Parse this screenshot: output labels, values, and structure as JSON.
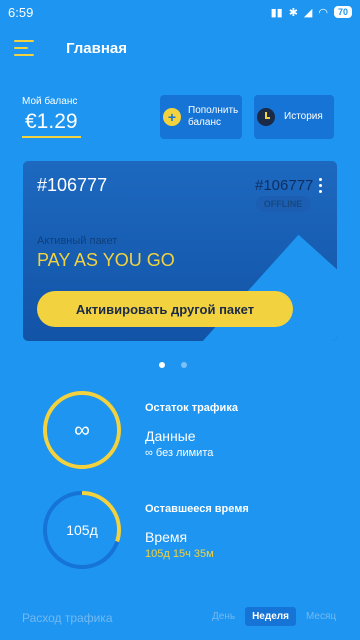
{
  "status_bar": {
    "time": "6:59",
    "battery": "70"
  },
  "header": {
    "title": "Главная"
  },
  "balance": {
    "label": "Мой баланс",
    "value": "€1.29"
  },
  "actions": {
    "topup_label_line1": "Пополнить",
    "topup_label_line2": "баланс",
    "history_label": "История"
  },
  "card": {
    "id": "#106777",
    "id_secondary": "#106777",
    "status": "OFFLINE",
    "package_label": "Активный пакет",
    "package_name": "PAY AS YOU GO",
    "activate_label": "Активировать другой пакет"
  },
  "pager": {
    "count": 2,
    "active": 0
  },
  "traffic": {
    "title": "Остаток трафика",
    "ring_text": "∞",
    "type": "Данные",
    "value": "∞ без лимита",
    "ring_fill": 1.0
  },
  "time_left": {
    "title": "Оставшееся время",
    "ring_text": "105д",
    "type": "Время",
    "value": "105д 15ч 35м",
    "ring_fill": 0.3
  },
  "footer": {
    "label": "Расход трафика",
    "tabs": [
      "День",
      "Неделя",
      "Месяц"
    ],
    "active_tab": 1
  },
  "colors": {
    "accent": "#f2d33f",
    "background": "#1e95f0",
    "card": "#1d69c0"
  }
}
